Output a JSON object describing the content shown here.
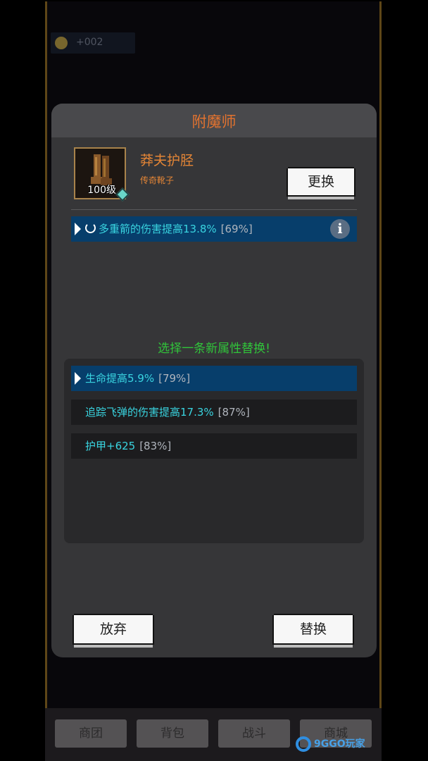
{
  "background": {
    "coin_amount": "+002",
    "nav": [
      "商团",
      "背包",
      "战斗",
      "商城"
    ],
    "watermark": "9GGO玩家"
  },
  "dialog": {
    "title": "附魔师",
    "item": {
      "name": "莽夫护胫",
      "type": "传奇靴子",
      "level": "100级",
      "icon": "boots-icon"
    },
    "replace_button": "更换",
    "current_attr": {
      "text": "多重箭的伤害提高13.8%",
      "percent": "[69%]"
    },
    "prompt": "选择一条新属性替换!",
    "options": [
      {
        "text": "生命提高5.9%",
        "percent": "[79%]",
        "selected": true
      },
      {
        "text": "追踪飞弹的伤害提高17.3%",
        "percent": "[87%]",
        "selected": false
      },
      {
        "text": "护甲+625",
        "percent": "[83%]",
        "selected": false
      }
    ],
    "abandon_button": "放弃",
    "confirm_button": "替换"
  },
  "colors": {
    "title": "#e3732f",
    "attribute_text": "#39d4e0",
    "selected_row": "#073e6b",
    "prompt": "#30c43a"
  }
}
